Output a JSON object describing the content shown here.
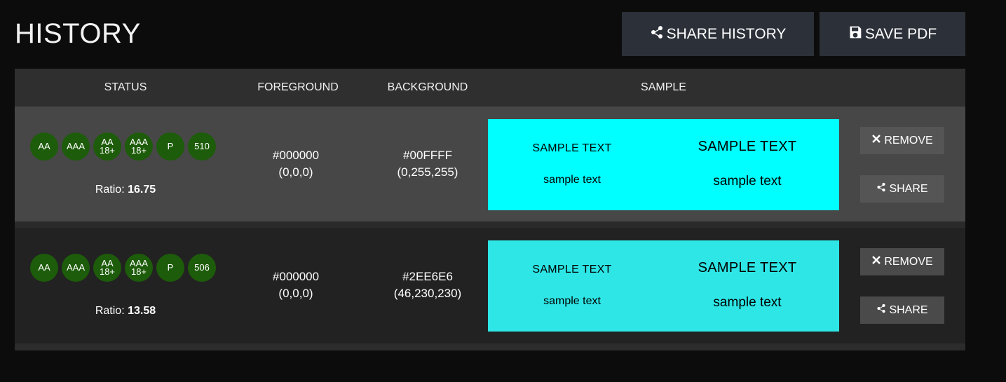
{
  "page": {
    "title": "HISTORY",
    "share_history_label": "SHARE HISTORY",
    "save_pdf_label": "SAVE PDF"
  },
  "table": {
    "headers": [
      "STATUS",
      "FOREGROUND",
      "BACKGROUND",
      "SAMPLE"
    ],
    "rows": [
      {
        "badges": [
          "AA",
          "AAA",
          "AA 18+",
          "AAA 18+",
          "P",
          "510"
        ],
        "ratio_label": "Ratio:",
        "ratio_value": "16.75",
        "fg_hex": "#000000",
        "fg_rgb": "(0,0,0)",
        "bg_hex": "#00FFFF",
        "bg_rgb": "(0,255,255)",
        "sample_bg": "#00FFFF",
        "sample_fg": "#000000",
        "sample_upper": "SAMPLE TEXT",
        "sample_lower": "sample text",
        "remove_label": "REMOVE",
        "share_label": "SHARE"
      },
      {
        "badges": [
          "AA",
          "AAA",
          "AA 18+",
          "AAA 18+",
          "P",
          "506"
        ],
        "ratio_label": "Ratio:",
        "ratio_value": "13.58",
        "fg_hex": "#000000",
        "fg_rgb": "(0,0,0)",
        "bg_hex": "#2EE6E6",
        "bg_rgb": "(46,230,230)",
        "sample_bg": "#2EE6E6",
        "sample_fg": "#000000",
        "sample_upper": "SAMPLE TEXT",
        "sample_lower": "sample text",
        "remove_label": "REMOVE",
        "share_label": "SHARE"
      }
    ]
  },
  "colors": {
    "badge_pass": "#1d5c0a",
    "button_bg": "#2c3038"
  }
}
